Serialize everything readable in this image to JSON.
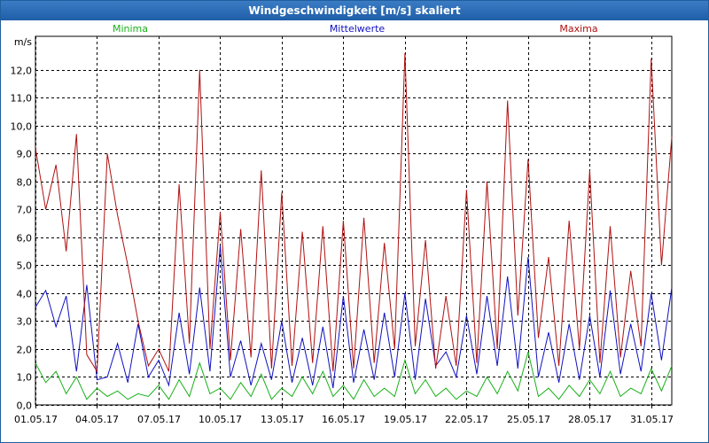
{
  "window": {
    "title": "Windgeschwindigkeit [m/s] skaliert"
  },
  "chart_data": {
    "type": "line",
    "title": "Windgeschwindigkeit [m/s] skaliert",
    "ylabel": "m/s",
    "xlabel": "",
    "ylim": [
      0,
      13.2
    ],
    "xlim": [
      0,
      31
    ],
    "grid": true,
    "yticks": [
      "0,0",
      "1,0",
      "2,0",
      "3,0",
      "4,0",
      "5,0",
      "6,0",
      "7,0",
      "8,0",
      "9,0",
      "10,0",
      "11,0",
      "12,0"
    ],
    "ytick_values": [
      0,
      1,
      2,
      3,
      4,
      5,
      6,
      7,
      8,
      9,
      10,
      11,
      12
    ],
    "xticks": [
      "01.05.17",
      "04.05.17",
      "07.05.17",
      "10.05.17",
      "13.05.17",
      "16.05.17",
      "19.05.17",
      "22.05.17",
      "25.05.17",
      "28.05.17",
      "31.05.17"
    ],
    "xtick_values": [
      0,
      3,
      6,
      9,
      12,
      15,
      18,
      21,
      24,
      27,
      30
    ],
    "series": [
      {
        "name": "Minima",
        "color": "#19b019",
        "x": [
          0,
          0.5,
          1,
          1.5,
          2,
          2.5,
          3,
          3.5,
          4,
          4.5,
          5,
          5.5,
          6,
          6.5,
          7,
          7.5,
          8,
          8.5,
          9,
          9.5,
          10,
          10.5,
          11,
          11.5,
          12,
          12.5,
          13,
          13.5,
          14,
          14.5,
          15,
          15.5,
          16,
          16.5,
          17,
          17.5,
          18,
          18.5,
          19,
          19.5,
          20,
          20.5,
          21,
          21.5,
          22,
          22.5,
          23,
          23.5,
          24,
          24.5,
          25,
          25.5,
          26,
          26.5,
          27,
          27.5,
          28,
          28.5,
          29,
          29.5,
          30,
          30.5,
          31
        ],
        "values": [
          1.5,
          0.8,
          1.2,
          0.4,
          1.0,
          0.2,
          0.6,
          0.3,
          0.5,
          0.2,
          0.4,
          0.3,
          0.7,
          0.2,
          0.9,
          0.3,
          1.5,
          0.4,
          0.6,
          0.2,
          0.8,
          0.3,
          1.1,
          0.2,
          0.6,
          0.3,
          1.0,
          0.4,
          1.2,
          0.3,
          0.7,
          0.2,
          0.9,
          0.3,
          0.6,
          0.3,
          1.6,
          0.4,
          0.9,
          0.3,
          0.6,
          0.2,
          0.5,
          0.3,
          1.0,
          0.4,
          1.2,
          0.5,
          1.9,
          0.3,
          0.6,
          0.2,
          0.7,
          0.3,
          0.9,
          0.4,
          1.2,
          0.3,
          0.6,
          0.4,
          1.3,
          0.5,
          1.4
        ]
      },
      {
        "name": "Mittelwerte",
        "color": "#1010c0",
        "x": [
          0,
          0.5,
          1,
          1.5,
          2,
          2.5,
          3,
          3.5,
          4,
          4.5,
          5,
          5.5,
          6,
          6.5,
          7,
          7.5,
          8,
          8.5,
          9,
          9.5,
          10,
          10.5,
          11,
          11.5,
          12,
          12.5,
          13,
          13.5,
          14,
          14.5,
          15,
          15.5,
          16,
          16.5,
          17,
          17.5,
          18,
          18.5,
          19,
          19.5,
          20,
          20.5,
          21,
          21.5,
          22,
          22.5,
          23,
          23.5,
          24,
          24.5,
          25,
          25.5,
          26,
          26.5,
          27,
          27.5,
          28,
          28.5,
          29,
          29.5,
          30,
          30.5,
          31
        ],
        "values": [
          3.5,
          4.1,
          2.8,
          3.9,
          1.2,
          4.3,
          0.9,
          1.0,
          2.2,
          0.8,
          2.9,
          1.0,
          1.6,
          0.7,
          3.3,
          1.1,
          4.2,
          1.2,
          5.7,
          1.0,
          2.3,
          0.7,
          2.2,
          0.9,
          3.0,
          0.8,
          2.4,
          0.7,
          2.8,
          0.6,
          3.9,
          0.8,
          2.7,
          0.9,
          3.3,
          1.0,
          4.0,
          0.9,
          3.8,
          1.4,
          1.9,
          1.0,
          3.2,
          1.1,
          3.9,
          1.4,
          4.6,
          1.3,
          5.3,
          1.0,
          2.6,
          0.8,
          2.9,
          0.9,
          3.2,
          1.0,
          4.1,
          1.1,
          2.9,
          1.2,
          4.0,
          1.6,
          4.2
        ]
      },
      {
        "name": "Maxima",
        "color": "#b01010",
        "x": [
          0,
          0.5,
          1,
          1.5,
          2,
          2.5,
          3,
          3.5,
          4,
          4.5,
          5,
          5.5,
          6,
          6.5,
          7,
          7.5,
          8,
          8.5,
          9,
          9.5,
          10,
          10.5,
          11,
          11.5,
          12,
          12.5,
          13,
          13.5,
          14,
          14.5,
          15,
          15.5,
          16,
          16.5,
          17,
          17.5,
          18,
          18.5,
          19,
          19.5,
          20,
          20.5,
          21,
          21.5,
          22,
          22.5,
          23,
          23.5,
          24,
          24.5,
          25,
          25.5,
          26,
          26.5,
          27,
          27.5,
          28,
          28.5,
          29,
          29.5,
          30,
          30.5,
          31
        ],
        "values": [
          9.2,
          7.0,
          8.6,
          5.5,
          9.7,
          1.8,
          1.2,
          9.0,
          6.8,
          5.0,
          3.0,
          1.4,
          2.0,
          1.2,
          7.9,
          2.2,
          12.0,
          2.0,
          6.9,
          1.6,
          6.3,
          1.7,
          8.4,
          1.3,
          7.6,
          1.4,
          6.2,
          1.5,
          6.4,
          1.2,
          6.6,
          1.3,
          6.7,
          1.5,
          5.8,
          2.0,
          12.6,
          2.1,
          5.9,
          1.3,
          3.9,
          1.4,
          7.7,
          1.5,
          8.0,
          2.0,
          10.9,
          3.2,
          8.8,
          2.4,
          5.3,
          1.4,
          6.6,
          2.0,
          8.4,
          1.5,
          6.4,
          1.7,
          4.8,
          2.1,
          12.4,
          5.0,
          9.6
        ]
      }
    ]
  }
}
